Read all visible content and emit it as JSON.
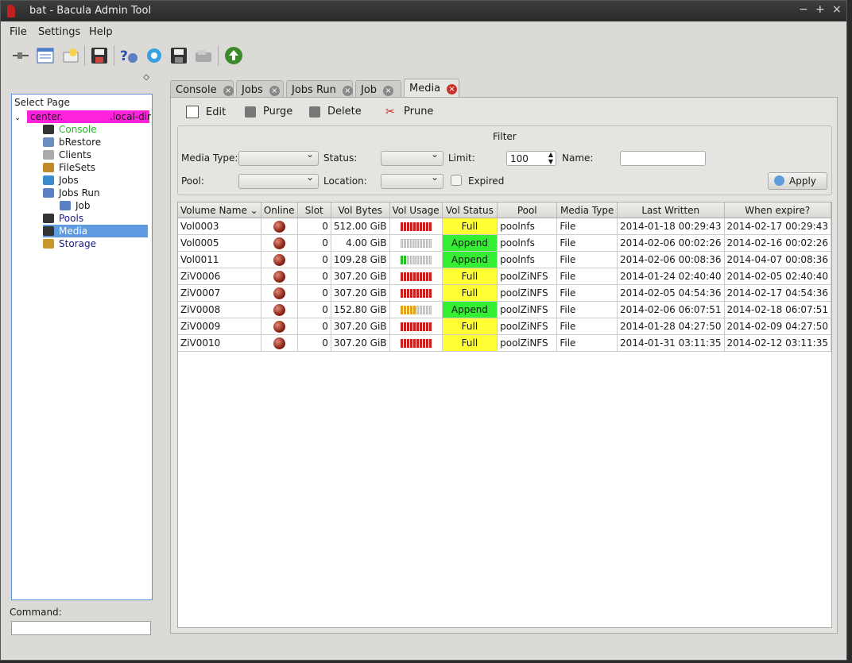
{
  "window": {
    "title": "bat - Bacula Admin Tool",
    "controls": [
      "−",
      "+",
      "×"
    ]
  },
  "menu": [
    "File",
    "Settings",
    "Help"
  ],
  "toolbar": [
    "connect-icon",
    "list-icon",
    "label-icon",
    "save-icon",
    "status-dir-icon",
    "run-job-icon",
    "restore-icon",
    "storage-icon",
    "upgrade-icon"
  ],
  "sidebar": {
    "title": "Select Page",
    "director_left": "center.",
    "director_right": ".local-dir",
    "items": [
      {
        "label": "Console",
        "icon": "console-icon",
        "color": "#22bb22"
      },
      {
        "label": "bRestore",
        "icon": "restore-icon",
        "color": "#1a1a1a"
      },
      {
        "label": "Clients",
        "icon": "client-icon",
        "color": "#1a1a1a"
      },
      {
        "label": "FileSets",
        "icon": "fileset-icon",
        "color": "#1a1a1a"
      },
      {
        "label": "Jobs",
        "icon": "jobs-icon",
        "color": "#1a1a1a"
      },
      {
        "label": "Jobs Run",
        "icon": "jobs-run-icon",
        "color": "#1a1a1a"
      },
      {
        "label": "Job",
        "icon": "job-icon",
        "color": "#1a1a1a"
      },
      {
        "label": "Pools",
        "icon": "pools-icon",
        "color": "#1a1a8a"
      },
      {
        "label": "Media",
        "icon": "media-icon",
        "color": "#1a1a8a"
      },
      {
        "label": "Storage",
        "icon": "storage-icon",
        "color": "#1a1a8a"
      }
    ],
    "command_label": "Command:"
  },
  "tabs": [
    "Console",
    "Jobs",
    "Jobs Run",
    "Job",
    "Media"
  ],
  "actions": {
    "edit": "Edit",
    "purge": "Purge",
    "delete": "Delete",
    "prune": "Prune"
  },
  "filter": {
    "title": "Filter",
    "media_type": "Media Type:",
    "status": "Status:",
    "limit": "Limit:",
    "limit_value": "100",
    "name": "Name:",
    "pool": "Pool:",
    "location": "Location:",
    "expired": "Expired",
    "apply": "Apply"
  },
  "table": {
    "headers": [
      "Volume Name",
      "Online",
      "Slot",
      "Vol Bytes",
      "Vol Usage",
      "Vol Status",
      "Pool",
      "Media Type",
      "Last Written",
      "When expire?"
    ],
    "rows": [
      {
        "name": "Vol0003",
        "slot": "0",
        "bytes": "512.00 GiB",
        "usage": 1.0,
        "status": "Full",
        "pool": "poolnfs",
        "type": "File",
        "last": "2014-01-18 00:29:43",
        "expire": "2014-02-17 00:29:43"
      },
      {
        "name": "Vol0005",
        "slot": "0",
        "bytes": "4.00 GiB",
        "usage": 0.0,
        "status": "Append",
        "pool": "poolnfs",
        "type": "File",
        "last": "2014-02-06 00:02:26",
        "expire": "2014-02-16 00:02:26"
      },
      {
        "name": "Vol0011",
        "slot": "0",
        "bytes": "109.28 GiB",
        "usage": 0.2,
        "status": "Append",
        "pool": "poolnfs",
        "type": "File",
        "last": "2014-02-06 00:08:36",
        "expire": "2014-04-07 00:08:36"
      },
      {
        "name": "ZiV0006",
        "slot": "0",
        "bytes": "307.20 GiB",
        "usage": 1.0,
        "status": "Full",
        "pool": "poolZiNFS",
        "type": "File",
        "last": "2014-01-24 02:40:40",
        "expire": "2014-02-05 02:40:40"
      },
      {
        "name": "ZiV0007",
        "slot": "0",
        "bytes": "307.20 GiB",
        "usage": 1.0,
        "status": "Full",
        "pool": "poolZiNFS",
        "type": "File",
        "last": "2014-02-05 04:54:36",
        "expire": "2014-02-17 04:54:36"
      },
      {
        "name": "ZiV0008",
        "slot": "0",
        "bytes": "152.80 GiB",
        "usage": 0.5,
        "status": "Append",
        "pool": "poolZiNFS",
        "type": "File",
        "last": "2014-02-06 06:07:51",
        "expire": "2014-02-18 06:07:51"
      },
      {
        "name": "ZiV0009",
        "slot": "0",
        "bytes": "307.20 GiB",
        "usage": 1.0,
        "status": "Full",
        "pool": "poolZiNFS",
        "type": "File",
        "last": "2014-01-28 04:27:50",
        "expire": "2014-02-09 04:27:50"
      },
      {
        "name": "ZiV0010",
        "slot": "0",
        "bytes": "307.20 GiB",
        "usage": 1.0,
        "status": "Full",
        "pool": "poolZiNFS",
        "type": "File",
        "last": "2014-01-31 03:11:35",
        "expire": "2014-02-12 03:11:35"
      }
    ]
  },
  "colors": {
    "full": "#ffff33",
    "append": "#33ee33",
    "director_highlight": "#ff22dd",
    "selection": "#5e9be0"
  }
}
